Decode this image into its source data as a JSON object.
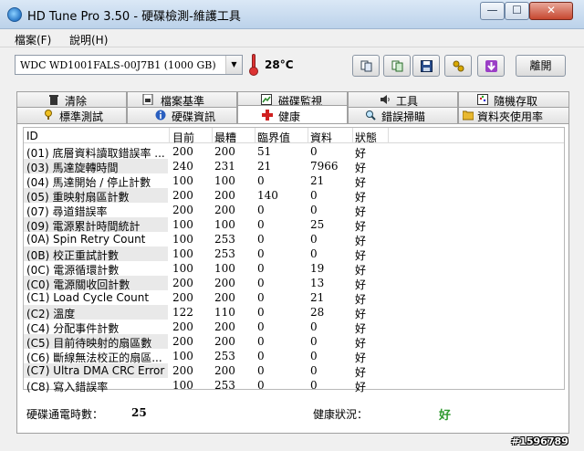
{
  "window": {
    "title": "HD Tune Pro 3.50 - 硬碟檢測-維護工具"
  },
  "window_buttons": {
    "minimize": "—",
    "maximize": "☐",
    "close": "✕"
  },
  "menu": [
    "檔案(F)",
    "說明(H)"
  ],
  "toolbar": {
    "drive": "WDC WD1001FALS-00J7B1 (1000 GB)",
    "temperature": "28°C",
    "exit_label": "離開",
    "icons": [
      "copy-icon",
      "copy-text-icon",
      "save-icon",
      "options-icon",
      "download-icon"
    ]
  },
  "tabs_row1": [
    {
      "label": "清除",
      "icon": "trash-icon"
    },
    {
      "label": "檔案基準",
      "icon": "file-benchmark-icon"
    },
    {
      "label": "磁碟監視",
      "icon": "monitor-icon"
    },
    {
      "label": "工具",
      "icon": "speaker-icon"
    },
    {
      "label": "隨機存取",
      "icon": "random-access-icon"
    }
  ],
  "tabs_row2": [
    {
      "label": "標準測試",
      "icon": "benchmark-icon"
    },
    {
      "label": "硬碟資訊",
      "icon": "info-icon"
    },
    {
      "label": "健康",
      "icon": "health-cross-icon"
    },
    {
      "label": "錯誤掃瞄",
      "icon": "magnifier-icon"
    },
    {
      "label": "資料夾使用率",
      "icon": "folder-icon"
    }
  ],
  "active_tab": "健康",
  "table": {
    "headers": [
      "ID",
      "目前",
      "最糟",
      "臨界值",
      "資料",
      "狀態"
    ],
    "rows": [
      [
        "(01) 底層資料讀取錯誤率 ...",
        "200",
        "200",
        "51",
        "0",
        "好"
      ],
      [
        "(03) 馬達旋轉時間",
        "240",
        "231",
        "21",
        "7966",
        "好"
      ],
      [
        "(04) 馬達開始 / 停止計數",
        "100",
        "100",
        "0",
        "21",
        "好"
      ],
      [
        "(05) 重映射扇區計數",
        "200",
        "200",
        "140",
        "0",
        "好"
      ],
      [
        "(07) 尋道錯誤率",
        "200",
        "200",
        "0",
        "0",
        "好"
      ],
      [
        "(09) 電源累計時間統計",
        "100",
        "100",
        "0",
        "25",
        "好"
      ],
      [
        "(0A) Spin Retry Count",
        "100",
        "253",
        "0",
        "0",
        "好"
      ],
      [
        "(0B) 校正重試計數",
        "100",
        "253",
        "0",
        "0",
        "好"
      ],
      [
        "(0C) 電源循環計數",
        "100",
        "100",
        "0",
        "19",
        "好"
      ],
      [
        "(C0) 電源關收回計數",
        "200",
        "200",
        "0",
        "13",
        "好"
      ],
      [
        "(C1) Load Cycle Count",
        "200",
        "200",
        "0",
        "21",
        "好"
      ],
      [
        "(C2) 溫度",
        "122",
        "110",
        "0",
        "28",
        "好"
      ],
      [
        "(C4) 分配事件計數",
        "200",
        "200",
        "0",
        "0",
        "好"
      ],
      [
        "(C5) 目前待映射的扇區數",
        "200",
        "200",
        "0",
        "0",
        "好"
      ],
      [
        "(C6) 斷線無法校正的扇區...",
        "100",
        "253",
        "0",
        "0",
        "好"
      ],
      [
        "(C7) Ultra DMA CRC Error ...",
        "200",
        "200",
        "0",
        "0",
        "好"
      ],
      [
        "(C8) 寫入錯誤率",
        "100",
        "253",
        "0",
        "0",
        "好"
      ]
    ]
  },
  "summary": {
    "power_on_label": "硬碟通電時數：",
    "power_on_value": "25",
    "health_label": "健康狀況：",
    "health_value": "好",
    "health_color": "#2e9a2e"
  },
  "watermark": "#1596789"
}
